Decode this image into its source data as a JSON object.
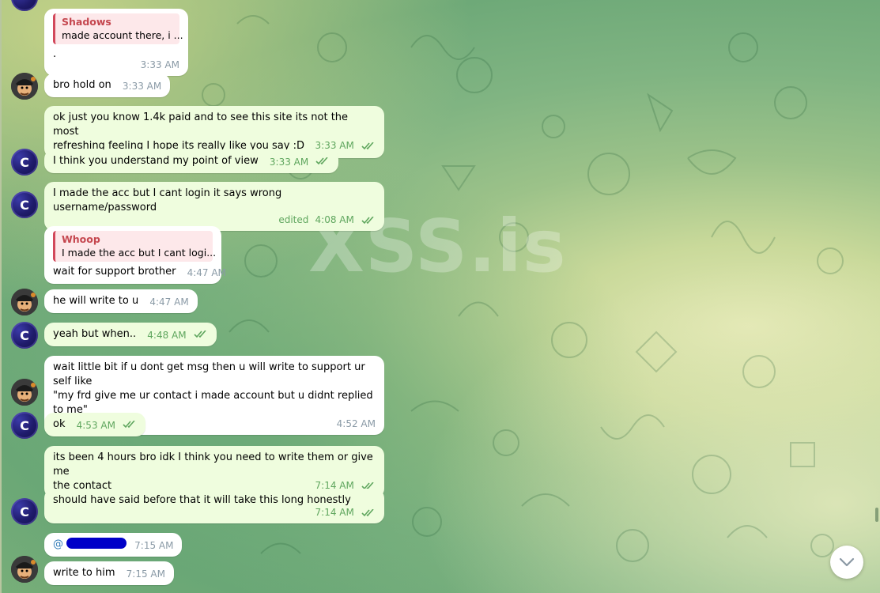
{
  "watermark": "XSS.is",
  "colors": {
    "incoming_bubble": "#ffffff",
    "outgoing_bubble": "#effdde",
    "reply_accent": "#d2485b",
    "avatar_c": "#1f1b6b",
    "meta_out": "#5fa65e"
  },
  "messages": [
    {
      "id": "m1",
      "dir": "in",
      "reply": {
        "name": "Shadows",
        "text": "made account there, i ..."
      },
      "text": ".",
      "time": "3:33 AM"
    },
    {
      "id": "m2",
      "dir": "in",
      "avatar": "pirate",
      "text": "bro hold on",
      "time": "3:33 AM"
    },
    {
      "id": "m3",
      "dir": "out",
      "text_lines": [
        "ok just you know 1.4k paid and to see this site its not the most",
        "refreshing feeling I hope its really like you say :D"
      ],
      "time": "3:33 AM",
      "status": "read"
    },
    {
      "id": "m4",
      "dir": "out",
      "avatar": "c",
      "text": "I think you understand my point of view",
      "time": "3:33 AM",
      "status": "read"
    },
    {
      "id": "m5",
      "dir": "out",
      "avatar": "c",
      "text": "I made the acc but I cant login it says wrong username/password",
      "edited": "edited",
      "time": "4:08 AM",
      "status": "read"
    },
    {
      "id": "m6",
      "dir": "in",
      "reply": {
        "name": "Whoop",
        "text": "I made the acc but I cant logi..."
      },
      "text": "wait for support brother",
      "time": "4:47 AM"
    },
    {
      "id": "m7",
      "dir": "in",
      "avatar": "pirate",
      "text": "he will write to u",
      "time": "4:47 AM"
    },
    {
      "id": "m8",
      "dir": "out",
      "avatar": "c",
      "text": "yeah but when..",
      "time": "4:48 AM",
      "status": "read"
    },
    {
      "id": "m9",
      "dir": "in",
      "avatar": "pirate",
      "text_lines": [
        "wait little bit if u dont get msg then u will write to support ur self like",
        "\"my frd give me ur contact i made account but u didnt replied to me\""
      ],
      "time": "4:52 AM"
    },
    {
      "id": "m10",
      "dir": "out",
      "avatar": "c",
      "text": "ok",
      "time": "4:53 AM",
      "status": "read"
    },
    {
      "id": "m11",
      "dir": "out",
      "text_lines": [
        "its been 4 hours bro idk I think you need to write them or give me",
        "the contact"
      ],
      "time": "7:14 AM",
      "status": "read"
    },
    {
      "id": "m12",
      "dir": "out",
      "avatar": "c",
      "text": "should have said before that it will take this long honestly",
      "time": "7:14 AM",
      "status": "read"
    },
    {
      "id": "m13",
      "dir": "in",
      "mention": "@",
      "text": "",
      "time": "7:15 AM"
    },
    {
      "id": "m14",
      "dir": "in",
      "avatar": "pirate",
      "text": "write to him",
      "time": "7:15 AM"
    }
  ],
  "icons": {
    "scroll_down": "chevron-down-icon",
    "read_status": "double-check-icon"
  }
}
